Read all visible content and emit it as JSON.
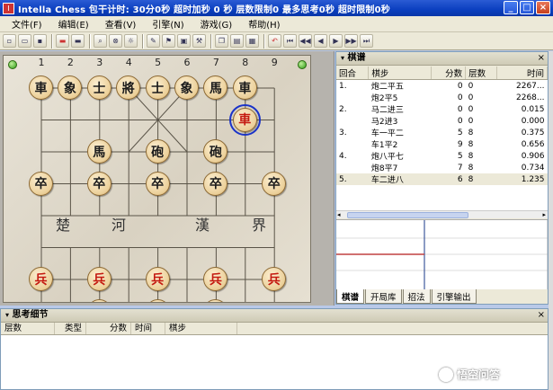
{
  "title": "Intella Chess 包干计时: 30分0秒 超时加秒 0 秒 层数限制0 最多思考0秒 超时限制0秒",
  "menu": [
    "文件(F)",
    "编辑(E)",
    "查看(V)",
    "引擎(N)",
    "游戏(G)",
    "帮助(H)"
  ],
  "window_controls": {
    "min": "_",
    "max": "□",
    "close": "×"
  },
  "board": {
    "column_numbers": [
      "1",
      "2",
      "3",
      "4",
      "5",
      "6",
      "7",
      "8",
      "9"
    ],
    "river_left": [
      "楚",
      "河"
    ],
    "river_right": [
      "漢",
      "界"
    ],
    "pieces": [
      {
        "ch": "車",
        "side": "black",
        "col": 0,
        "row": 0
      },
      {
        "ch": "象",
        "side": "black",
        "col": 1,
        "row": 0
      },
      {
        "ch": "士",
        "side": "black",
        "col": 2,
        "row": 0
      },
      {
        "ch": "將",
        "side": "black",
        "col": 3,
        "row": 0
      },
      {
        "ch": "士",
        "side": "black",
        "col": 4,
        "row": 0
      },
      {
        "ch": "象",
        "side": "black",
        "col": 5,
        "row": 0
      },
      {
        "ch": "馬",
        "side": "black",
        "col": 6,
        "row": 0
      },
      {
        "ch": "車",
        "side": "black",
        "col": 7,
        "row": 0
      },
      {
        "ch": "車",
        "side": "red",
        "col": 7,
        "row": 1,
        "selected": true
      },
      {
        "ch": "馬",
        "side": "black",
        "col": 2,
        "row": 2
      },
      {
        "ch": "砲",
        "side": "black",
        "col": 4,
        "row": 2
      },
      {
        "ch": "砲",
        "side": "black",
        "col": 6,
        "row": 2
      },
      {
        "ch": "卒",
        "side": "black",
        "col": 0,
        "row": 3
      },
      {
        "ch": "卒",
        "side": "black",
        "col": 2,
        "row": 3
      },
      {
        "ch": "卒",
        "side": "black",
        "col": 4,
        "row": 3
      },
      {
        "ch": "卒",
        "side": "black",
        "col": 6,
        "row": 3
      },
      {
        "ch": "卒",
        "side": "black",
        "col": 8,
        "row": 3
      },
      {
        "ch": "兵",
        "side": "red",
        "col": 0,
        "row": 6
      },
      {
        "ch": "兵",
        "side": "red",
        "col": 2,
        "row": 6
      },
      {
        "ch": "兵",
        "side": "red",
        "col": 4,
        "row": 6
      },
      {
        "ch": "兵",
        "side": "red",
        "col": 6,
        "row": 6
      },
      {
        "ch": "兵",
        "side": "red",
        "col": 8,
        "row": 6
      },
      {
        "ch": "炮",
        "side": "red",
        "col": 2,
        "row": 7
      },
      {
        "ch": "炮",
        "side": "red",
        "col": 4,
        "row": 7
      },
      {
        "ch": "馬",
        "side": "red",
        "col": 6,
        "row": 7
      }
    ]
  },
  "qipu": {
    "title": "棋谱",
    "close": "×",
    "headers": [
      "回合",
      "棋步",
      "分数",
      "层数",
      "时间"
    ],
    "rows": [
      {
        "round": "1.",
        "move": "炮二平五",
        "score": "0",
        "depth": "0",
        "time": "2267..."
      },
      {
        "round": "",
        "move": "炮2平5",
        "score": "0",
        "depth": "0",
        "time": "2268..."
      },
      {
        "round": "2.",
        "move": "马二进三",
        "score": "0",
        "depth": "0",
        "time": "0.015"
      },
      {
        "round": "",
        "move": "马2进3",
        "score": "0",
        "depth": "0",
        "time": "0.000"
      },
      {
        "round": "3.",
        "move": "车一平二",
        "score": "5",
        "depth": "8",
        "time": "0.375"
      },
      {
        "round": "",
        "move": "车1平2",
        "score": "9",
        "depth": "8",
        "time": "0.656"
      },
      {
        "round": "4.",
        "move": "炮八平七",
        "score": "5",
        "depth": "8",
        "time": "0.906"
      },
      {
        "round": "",
        "move": "炮8平7",
        "score": "7",
        "depth": "8",
        "time": "0.734"
      },
      {
        "round": "5.",
        "move": "车二进八",
        "score": "6",
        "depth": "8",
        "time": "1.235"
      }
    ],
    "tabs": [
      "棋谱",
      "开局库",
      "招法",
      "引擎输出"
    ]
  },
  "analysis": {
    "title": "思考细节",
    "close": "×",
    "headers": [
      "层数",
      "类型",
      "分数",
      "时间",
      "棋步"
    ]
  },
  "watermark": "悟空问答",
  "colors": {
    "titlebar": "#0b3fbf",
    "red_piece": "#c41a10",
    "graph_line": "#c04040"
  }
}
